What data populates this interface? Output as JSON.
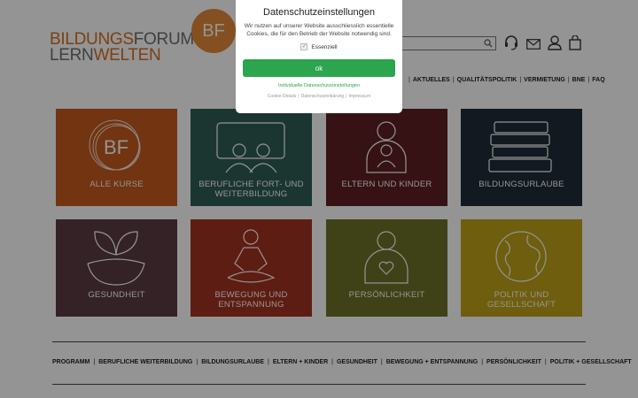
{
  "logo": {
    "line1_a": "BILDUNGS",
    "line1_b": "FORUM",
    "line2_a": "LERN",
    "line2_b": "WELTEN",
    "badge": "BF"
  },
  "header": {
    "icons": [
      "search-icon",
      "headset-icon",
      "mail-icon",
      "user-icon",
      "bag-icon"
    ]
  },
  "top_nav": [
    "AKTUELLES",
    "QUALITÄTSPOLITIK",
    "VERMIETUNG",
    "BNE",
    "FAQ"
  ],
  "tiles": [
    {
      "label": "ALLE KURSE",
      "color": "#c45a1e",
      "icon": "bf-circle-icon"
    },
    {
      "label": "BERUFLICHE FORT- UND WEITERBILDUNG",
      "color": "#2f5d55",
      "icon": "presentation-icon"
    },
    {
      "label": "ELTERN UND KINDER",
      "color": "#5e1f24",
      "icon": "parent-child-icon"
    },
    {
      "label": "BILDUNGSURLAUBE",
      "color": "#1f2b38",
      "icon": "books-icon"
    },
    {
      "label": "GESUNDHEIT",
      "color": "#5a3b43",
      "icon": "plant-icon"
    },
    {
      "label": "BEWEGUNG UND ENTSPANNUNG",
      "color": "#a3321f",
      "icon": "meditation-icon"
    },
    {
      "label": "PERSÖNLICHKEIT",
      "color": "#6c7227",
      "icon": "person-heart-icon"
    },
    {
      "label": "POLITIK UND GESELLSCHAFT",
      "color": "#bfa218",
      "icon": "globe-icon"
    }
  ],
  "footer_nav": [
    "PROGRAMM",
    "BERUFLICHE WEITERBILDUNG",
    "BILDUNGSURLAUBE",
    "ELTERN + KINDER",
    "GESUNDHEIT",
    "BEWEGUNG + ENTSPANNUNG",
    "PERSÖNLICHKEIT",
    "POLITIK + GESELLSCHAFT"
  ],
  "modal": {
    "title": "Datenschutzeinstellungen",
    "text": "Wir nutzen auf unserer Website ausschliesslich essentielle Cookies, die für den Betrieb der Website notwendig sind.",
    "checkbox_label": "Essenziell",
    "ok_label": "ok",
    "individual_link": "Individuelle Datenschutzeinstellungen",
    "links": [
      "Cookie-Details",
      "Datenschutzerklärung",
      "Impressum"
    ],
    "accent": "#2da44e"
  }
}
